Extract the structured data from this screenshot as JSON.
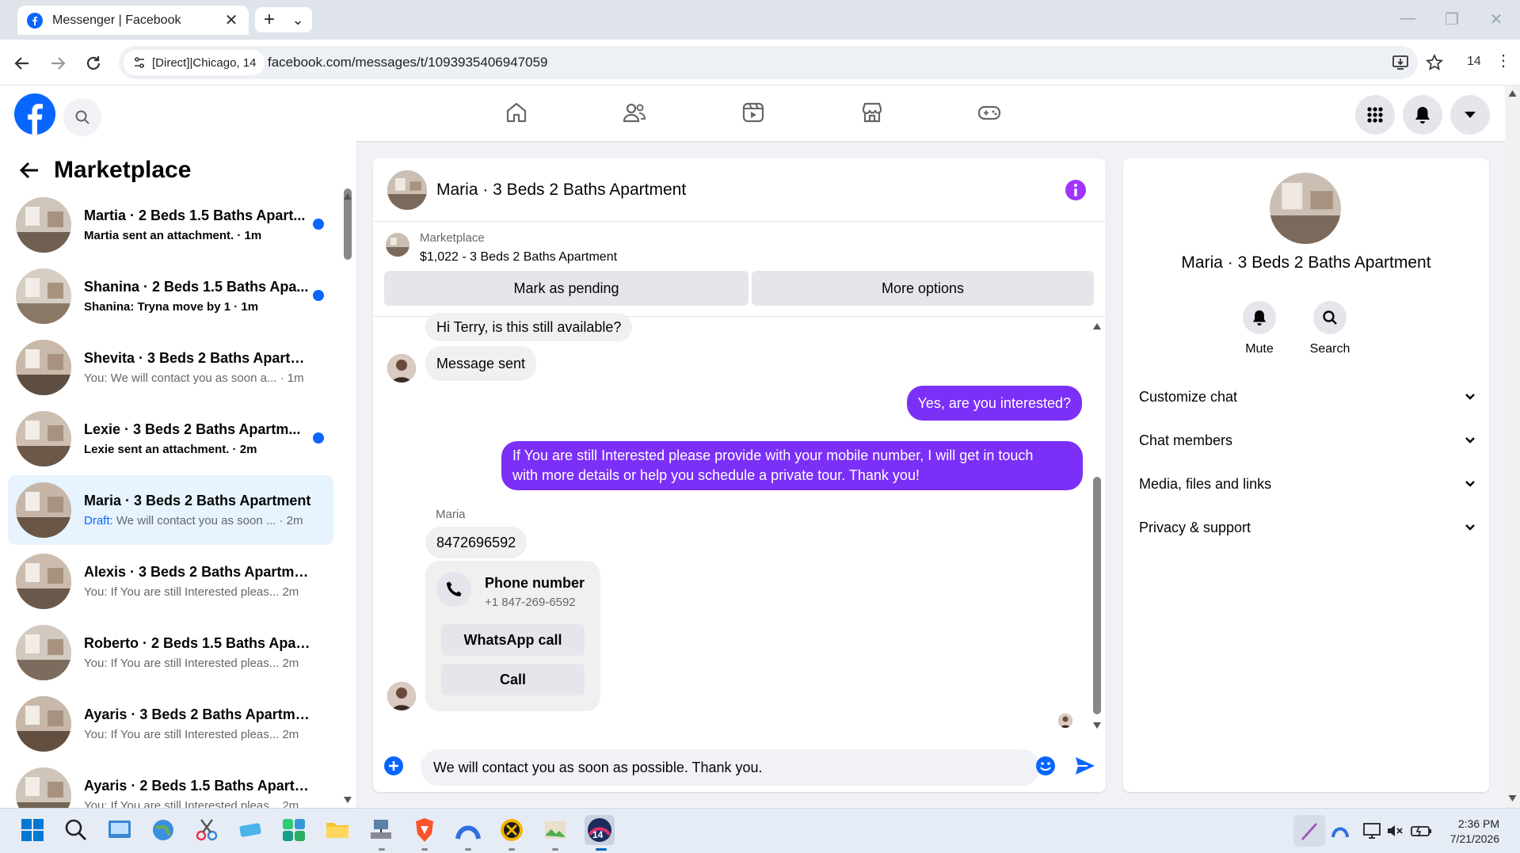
{
  "browser": {
    "tab_title": "Messenger | Facebook",
    "tab_close": "✕",
    "new_tab": "+",
    "tab_menu": "⌄",
    "site_info": "[Direct]|Chicago, 14",
    "url": "facebook.com/messages/t/1093935406947059",
    "ext_badge": "14",
    "menu": "⋮"
  },
  "sidebar": {
    "title": "Marketplace",
    "conversations": [
      {
        "name": "Martia · 2 Beds 1.5 Baths Apart...",
        "preview": "Martia sent an attachment. · 1m",
        "unread": true
      },
      {
        "name": "Shanina · 2 Beds 1.5 Baths Apa...",
        "preview": "Shanina: Tryna move by 1 · 1m",
        "unread": true
      },
      {
        "name": "Shevita · 3 Beds 2 Baths Apartm...",
        "preview": "You: We will contact you as soon a... · 1m",
        "unread": false
      },
      {
        "name": "Lexie · 3 Beds 2 Baths Apartm...",
        "preview": "Lexie sent an attachment. · 2m",
        "unread": true
      },
      {
        "name": "Maria · 3 Beds 2 Baths Apartment",
        "draft_label": "Draft:",
        "preview": " We will contact you as soon ... · 2m",
        "unread": false
      },
      {
        "name": "Alexis · 3 Beds 2 Baths Apartment",
        "preview": "You: If You are still Interested pleas...  2m",
        "unread": false
      },
      {
        "name": "Roberto · 2 Beds 1.5 Baths Apart...",
        "preview": "You: If You are still Interested pleas...  2m",
        "unread": false
      },
      {
        "name": "Ayaris · 3 Beds 2 Baths Apartment",
        "preview": "You: If You are still Interested pleas...  2m",
        "unread": false
      },
      {
        "name": "Ayaris · 2 Beds 1.5 Baths Apartm...",
        "preview": "You: If You are still Interested pleas...  2m",
        "unread": false
      }
    ]
  },
  "chat": {
    "title": "Maria · 3 Beds 2 Baths Apartment",
    "marketplace_label": "Marketplace",
    "listing": "$1,022 - 3 Beds 2 Baths Apartment",
    "mark_pending": "Mark as pending",
    "more_options": "More options",
    "messages": {
      "m1": "Hi Terry, is this still available?",
      "m2": "Message sent",
      "m3": "Yes, are you interested?",
      "m4_line1": "If You are still Interested please provide with your mobile number, I will get in touch",
      "m4_line2": "with more details or help you schedule a private tour. Thank you!",
      "sender": "Maria",
      "m5": "8472696592"
    },
    "phone_card": {
      "title": "Phone number",
      "number": "+1 847-269-6592",
      "whatsapp": "WhatsApp call",
      "call": "Call"
    },
    "composer_value": "We will contact you as soon as possible. Thank you."
  },
  "info_panel": {
    "title": "Maria · 3 Beds 2 Baths Apartment",
    "mute": "Mute",
    "search": "Search",
    "sections": [
      "Customize chat",
      "Chat members",
      "Media, files and links",
      "Privacy & support"
    ]
  },
  "taskbar": {
    "time": "2:36 PM",
    "date": "7/21/2026",
    "badge": "14"
  },
  "colors": {
    "fb_blue": "#0866ff",
    "outgoing_bubble": "#7b2ff7",
    "info_purple": "#a033ff"
  }
}
